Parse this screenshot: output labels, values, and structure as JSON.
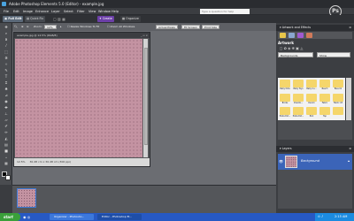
{
  "window": {
    "title": "Adobe Photoshop Elements 5.0 (Editor) - example.jpg"
  },
  "menu": [
    "File",
    "Edit",
    "Image",
    "Enhance",
    "Layer",
    "Select",
    "Filter",
    "View",
    "Window",
    "Help"
  ],
  "help_search": {
    "placeholder": "Type a question for help"
  },
  "mode_bar": {
    "full_edit": "Full Edit",
    "quick_fix": "Quick Fix",
    "create": "Create",
    "organize": "Organize"
  },
  "options_bar": {
    "zoom_label": "Zoom:",
    "zoom_value": "12%",
    "resize_windows": "Resize Windows To Fit",
    "zoom_all_windows": "Zoom All Windows",
    "actual_pixels": "Actual Pixels",
    "fit_screen": "Fit Screen",
    "print_size": "Print Size"
  },
  "document": {
    "title": "example.jpg @ 12.5% (RGB/8)",
    "status_zoom": "12.5%",
    "status_size": "30.48 cm x 30.48 cm (300 ppi)"
  },
  "right_panel": {
    "artwork_header": "Artwork and Effects",
    "artwork_title": "Artwork",
    "category_select": "Backgrounds",
    "filter_select": "Show",
    "artwork_items": [
      "Baby Dots",
      "Baby Toys",
      "Baby Cu...",
      "Beach",
      "Blue 01",
      "Bricks",
      "Checkb...",
      "Denim",
      "Fabric",
      "Fabric 03",
      "Polka Dot...",
      "Polka Dot...",
      "Pink",
      "Tap",
      ""
    ],
    "layers_header": "Layers",
    "layer_blend": "Normal",
    "layer_opacity_label": "Opacity:",
    "layer_name": "Background"
  },
  "taskbar": {
    "start": "start",
    "tasks": [
      "Organizer - Photosho...",
      "Editor - Photoshop El..."
    ],
    "clock": "2:15 AM"
  },
  "colors": {
    "canvas": "#c493a2",
    "dots": "#8a5f71",
    "selection": "#3b64b8",
    "taskbar": "#2759c4"
  }
}
